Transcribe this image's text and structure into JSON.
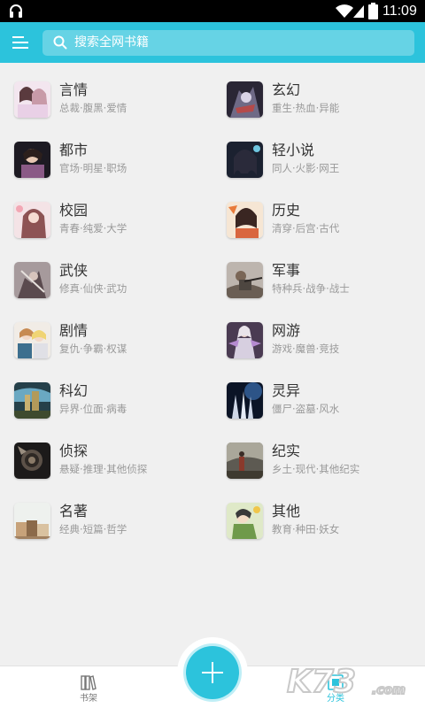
{
  "status_bar": {
    "time": "11:09"
  },
  "app_bar": {
    "search_placeholder": "搜索全网书籍"
  },
  "categories": [
    {
      "title": "言情",
      "subtitle": "总裁·腹黑·爱情",
      "icon": "romance-cover"
    },
    {
      "title": "玄幻",
      "subtitle": "重生·热血·异能",
      "icon": "fantasy-cover"
    },
    {
      "title": "都市",
      "subtitle": "官场·明星·职场",
      "icon": "urban-cover"
    },
    {
      "title": "轻小说",
      "subtitle": "同人·火影·网王",
      "icon": "light-novel-cover"
    },
    {
      "title": "校园",
      "subtitle": "青春·纯爱·大学",
      "icon": "campus-cover"
    },
    {
      "title": "历史",
      "subtitle": "清穿·后宫·古代",
      "icon": "history-cover"
    },
    {
      "title": "武侠",
      "subtitle": "修真·仙侠·武功",
      "icon": "wuxia-cover"
    },
    {
      "title": "军事",
      "subtitle": "特种兵·战争·战士",
      "icon": "military-cover"
    },
    {
      "title": "剧情",
      "subtitle": "复仇·争霸·权谋",
      "icon": "drama-cover"
    },
    {
      "title": "网游",
      "subtitle": "游戏·魔兽·竞技",
      "icon": "online-game-cover"
    },
    {
      "title": "科幻",
      "subtitle": "异界·位面·病毒",
      "icon": "scifi-cover"
    },
    {
      "title": "灵异",
      "subtitle": "僵尸·盗墓·风水",
      "icon": "supernatural-cover"
    },
    {
      "title": "侦探",
      "subtitle": "悬疑·推理·其他侦探",
      "icon": "detective-cover"
    },
    {
      "title": "纪实",
      "subtitle": "乡土·现代·其他纪实",
      "icon": "documentary-cover"
    },
    {
      "title": "名著",
      "subtitle": "经典·短篇·哲学",
      "icon": "classics-cover"
    },
    {
      "title": "其他",
      "subtitle": "教育·种田·妖女",
      "icon": "other-cover"
    }
  ],
  "bottom_nav": {
    "shelf_label": "书架",
    "category_label": "分类"
  },
  "colors": {
    "accent": "#2cc3dc",
    "background": "#f0f0f0"
  },
  "watermark": "K73.com"
}
